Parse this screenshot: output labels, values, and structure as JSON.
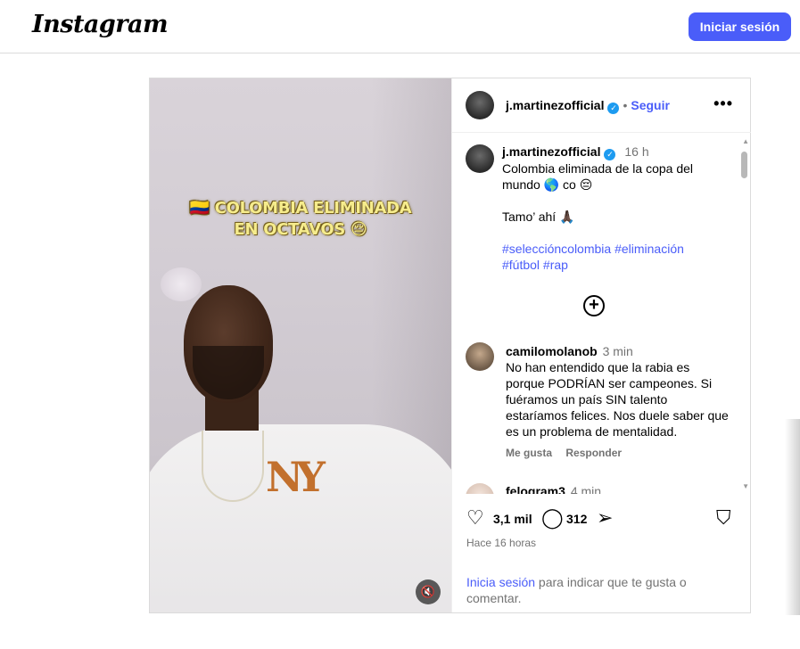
{
  "header": {
    "logo_text": "Instagram",
    "login_button": "Iniciar sesión"
  },
  "media": {
    "overlay_flag_icon": "colombia-flag-icon",
    "overlay_line1": "🇨🇴 COLOMBIA ELIMINADA",
    "overlay_line2": "EN OCTAVOS 😔",
    "shirt_logo": "NY",
    "mute_icon": "speaker-muted-icon"
  },
  "post_header": {
    "username": "j.martinezofficial",
    "verified": true,
    "separator": "•",
    "follow_label": "Seguir",
    "more_icon": "more-options-icon",
    "more_label": "•••"
  },
  "caption": {
    "username": "j.martinezofficial",
    "time": "16 h",
    "line1": "Colombia eliminada de la copa del",
    "line2": "mundo 🌎 co 😔",
    "line3": "Tamo’ ahí 🙏🏿",
    "hashtags_line1": "#seleccióncolombia #eliminación",
    "hashtags_line2": "#fútbol #rap",
    "load_more_icon": "plus-circle-icon"
  },
  "comments": [
    {
      "username": "camilomolanob",
      "time": "3 min",
      "lines": [
        "No han entendido que la rabia es",
        "porque PODRÍAN ser campeones. Si",
        "fuéramos un país SIN talento",
        "estaríamos felices. Nos duele saber que",
        "es un problema de mentalidad."
      ],
      "like_label": "Me gusta",
      "reply_label": "Responder"
    },
    {
      "username": "felogram3",
      "time": "4 min"
    }
  ],
  "actions": {
    "like_icon": "heart-icon",
    "like_count": "3,1 mil",
    "comment_icon": "comment-icon",
    "comment_count": "312",
    "share_icon": "paper-plane-icon",
    "save_icon": "bookmark-icon",
    "posted_ago": "Hace 16 horas"
  },
  "login_prompt": {
    "link": "Inicia sesión",
    "rest": " para indicar que te gusta o comentar."
  }
}
